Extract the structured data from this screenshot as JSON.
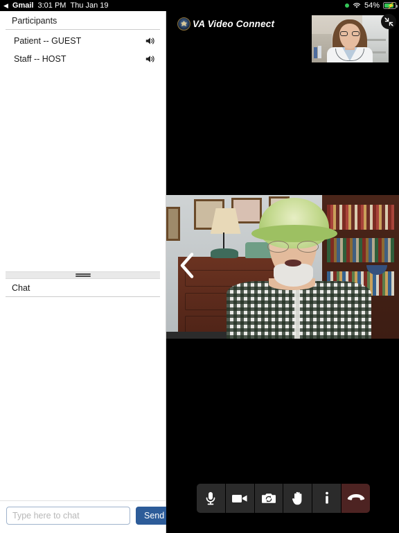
{
  "status_bar": {
    "back_glyph": "◀",
    "app_name": "Gmail",
    "time": "3:01 PM",
    "date": "Thu Jan 19",
    "battery_percent": "54%",
    "icons": [
      "green-dot-icon",
      "wifi-icon",
      "battery-charging-icon"
    ]
  },
  "sidebar": {
    "participants_title": "Participants",
    "participants": [
      {
        "label": "Patient -- GUEST",
        "speaker_icon": "speaker-icon"
      },
      {
        "label": "Staff -- HOST",
        "speaker_icon": "speaker-icon"
      }
    ],
    "divider": {
      "name": "panel-resize-handle"
    },
    "chat_title": "Chat",
    "chat_input_placeholder": "Type here to chat",
    "chat_input_value": "",
    "send_label": "Send"
  },
  "video": {
    "brand_title": "VA Video Connect",
    "brand_logo": "va-seal-icon",
    "collapse_icon": "collapse-arrows-icon",
    "prev_icon": "chevron-left-icon",
    "self_view": {
      "name": "self-view-thumbnail"
    },
    "remote_view": {
      "name": "remote-participant-video"
    }
  },
  "controls": [
    {
      "name": "microphone-button",
      "icon": "microphone-icon"
    },
    {
      "name": "camera-button",
      "icon": "video-camera-icon"
    },
    {
      "name": "switch-camera-button",
      "icon": "camera-flip-icon"
    },
    {
      "name": "raise-hand-button",
      "icon": "hand-icon"
    },
    {
      "name": "info-button",
      "icon": "info-icon"
    },
    {
      "name": "end-call-button",
      "icon": "hang-up-icon"
    }
  ],
  "colors": {
    "accent_blue": "#2d5c99",
    "end_call_red": "#4d2322",
    "battery_green": "#35c759",
    "panel_bg": "#ffffff",
    "stage_bg": "#000000"
  }
}
